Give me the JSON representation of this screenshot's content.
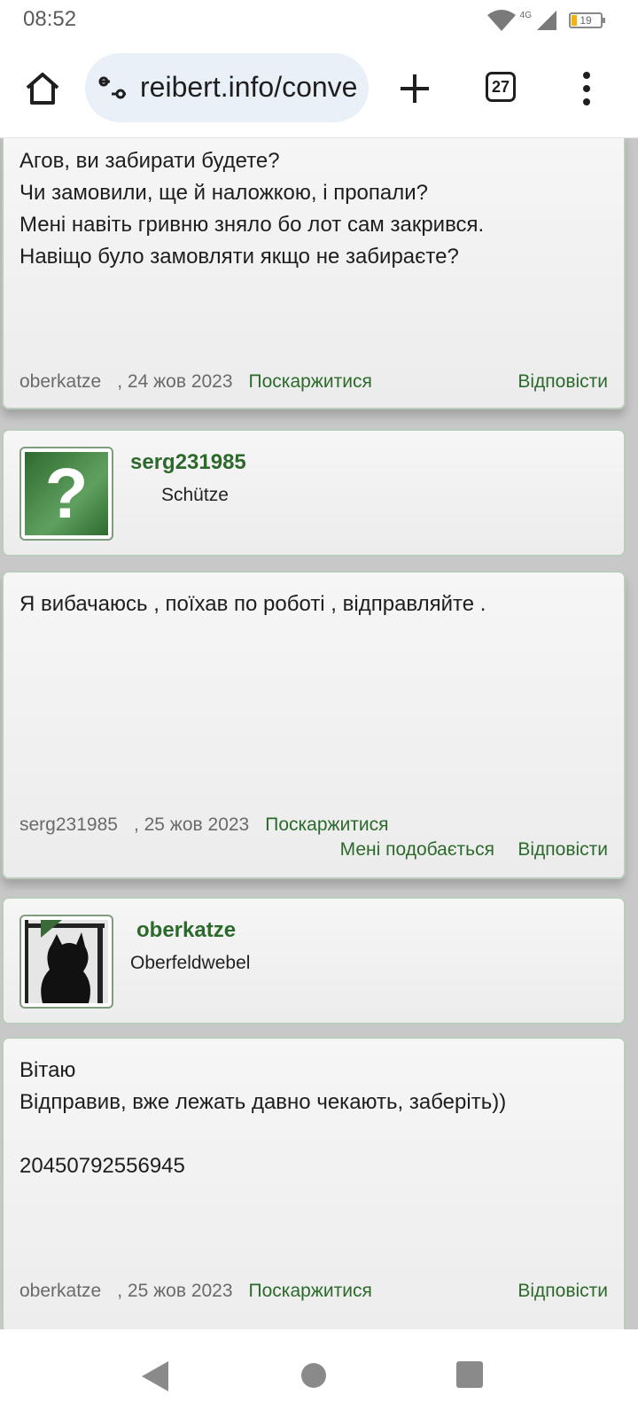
{
  "status_bar": {
    "time": "08:52",
    "network": "4G",
    "battery_text": "19",
    "battery_level": 0.19
  },
  "browser": {
    "url": "reibert.info/conversations",
    "tab_count": "27",
    "icons": [
      "home-icon",
      "tune-icon",
      "plus-icon",
      "tabs-icon",
      "more-vert-icon"
    ]
  },
  "posts": [
    {
      "type": "message",
      "lines": [
        "Агов, ви забирати будете?",
        "Чи замовили, ще й наложкою, і пропали?",
        "Мені навіть гривню зняло бо лот сам закрився.",
        "Навіщо було замовляти якщо не забираєте?"
      ],
      "author": "oberkatze",
      "date": ", 24 жов 2023",
      "report": "Поскаржитися",
      "reply": "Відповісти"
    },
    {
      "type": "user",
      "username": "serg231985",
      "rank": "Schütze",
      "avatar": "question-mark-avatar"
    },
    {
      "type": "message",
      "lines": [
        "Я вибачаюсь , поїхав по роботі , відправляйте ."
      ],
      "author": "serg231985",
      "date": ", 25 жов 2023",
      "report": "Поскаржитися",
      "like": "Мені подобається",
      "reply": "Відповісти"
    },
    {
      "type": "user",
      "username": "oberkatze",
      "rank": "Oberfeldwebel",
      "avatar": "cat-silhouette-avatar"
    },
    {
      "type": "message",
      "lines": [
        "Вітаю",
        "Відправив, вже лежать давно чекають, заберіть))",
        "",
        "20450792556945"
      ],
      "author": "oberkatze",
      "date": ", 25 жов 2023",
      "report": "Поскаржитися",
      "reply": "Відповісти"
    }
  ],
  "nav_bar": {
    "icons": [
      "back-icon",
      "home-circle-icon",
      "recents-icon"
    ]
  },
  "colors": {
    "accent_green": "#2c6a2c",
    "card_border": "#bcccbc",
    "url_bg": "#eaf0f7"
  }
}
